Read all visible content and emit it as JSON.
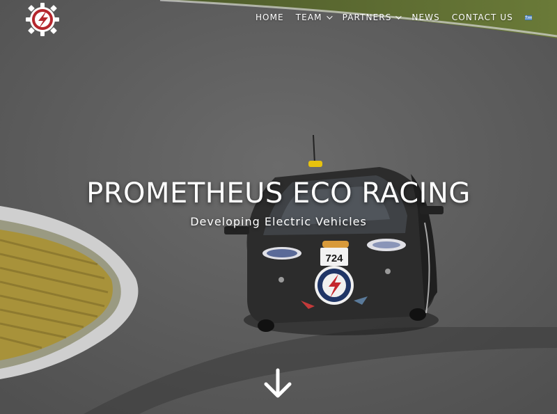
{
  "nav": {
    "items": [
      {
        "label": "HOME",
        "dropdown": false
      },
      {
        "label": "TEAM",
        "dropdown": true
      },
      {
        "label": "PARTNERS",
        "dropdown": true
      },
      {
        "label": "NEWS",
        "dropdown": false
      },
      {
        "label": "CONTACT US",
        "dropdown": false
      }
    ],
    "language_flag": "greek-flag-icon"
  },
  "hero": {
    "title": "PROMETHEUS ECO RACING",
    "subtitle": "Developing Electric Vehicles",
    "car_number": "724"
  },
  "logo": {
    "icon": "gear-lightning-logo",
    "colors": [
      "#b5272d",
      "#ffffff"
    ]
  },
  "colors": {
    "text": "#ffffff",
    "accent": "#b5272d"
  }
}
